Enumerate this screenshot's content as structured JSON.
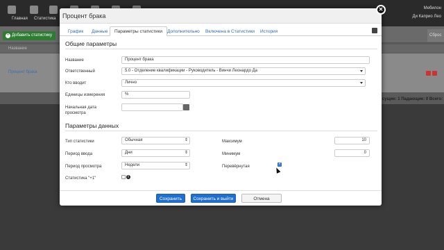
{
  "background": {
    "nav": [
      {
        "label": "Главная"
      },
      {
        "label": "Статистика"
      },
      {
        "label": ""
      },
      {
        "label": ""
      },
      {
        "label": ""
      },
      {
        "label": ""
      },
      {
        "label": ""
      }
    ],
    "user": {
      "line1": "Мебилон",
      "line2": "Ди Каприо Лео"
    },
    "add_button": "Добавить статистику",
    "right_button": "Сброс",
    "table_header": "Название",
    "row_name": "Процент брака",
    "footer": "сущие: 1 Падающие: 0 Всего:"
  },
  "modal": {
    "title": "Процент брака",
    "tabs": [
      {
        "label": "График"
      },
      {
        "label": "Данные"
      },
      {
        "label": "Параметры статистики"
      },
      {
        "label": "Дополнительно"
      },
      {
        "label": "Включена в Статистики"
      },
      {
        "label": "История"
      }
    ],
    "general": {
      "title": "Общие параметры",
      "name_label": "Название",
      "name_value": "Процент брака",
      "responsible_label": "Ответственный",
      "responsible_value": "5.0 - Отделение квалификации - Руководитель - Винчи Леонардо Да",
      "who_enters_label": "Кто вводит",
      "who_enters_value": "Лично",
      "units_label": "Единицы измерения",
      "units_value": "%",
      "start_date_label_1": "Начальная дата",
      "start_date_label_2": "просмотра",
      "start_date_value": ""
    },
    "data_params": {
      "title": "Параметры данных",
      "type_label": "Тип статистики",
      "type_value": "Обычная",
      "input_period_label": "Период ввода",
      "input_period_value": "Дни",
      "view_period_label": "Период просмотра",
      "view_period_value": "Недели",
      "plus_one_label": "Статистика \"+1\"",
      "max_label": "Максимум",
      "max_value": "10",
      "min_label": "Минимум",
      "min_value": "0",
      "inverted_label": "Перевёрнутая"
    },
    "buttons": {
      "save": "Сохранить",
      "save_exit": "Сохранить и выйти",
      "cancel": "Отмена"
    }
  },
  "colors": {
    "primary": "#1f6fd1",
    "link": "#2a6ebb",
    "success": "#2e7d32"
  }
}
